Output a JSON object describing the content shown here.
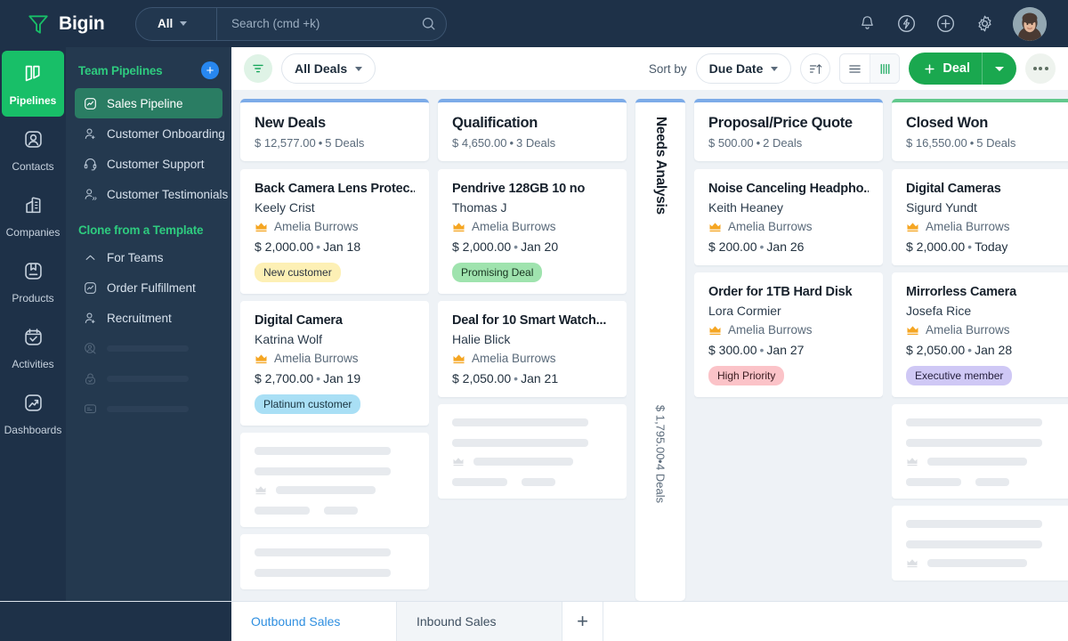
{
  "topbar": {
    "brand": "Bigin",
    "logo_icon": "funnel-logo-icon",
    "search_scope": "All",
    "search_placeholder": "Search (cmd +k)",
    "search_value": "",
    "icons": [
      {
        "name": "bell-icon",
        "label": "Notifications"
      },
      {
        "name": "bolt-icon",
        "label": "Quick actions"
      },
      {
        "name": "plus-circle-icon",
        "label": "Add"
      },
      {
        "name": "gear-icon",
        "label": "Settings"
      }
    ],
    "avatar_alt": "User profile"
  },
  "rail": {
    "items": [
      {
        "label": "Pipelines",
        "icon": "pipelines-icon",
        "active": true
      },
      {
        "label": "Contacts",
        "icon": "contacts-icon",
        "active": false
      },
      {
        "label": "Companies",
        "icon": "companies-icon",
        "active": false
      },
      {
        "label": "Products",
        "icon": "products-icon",
        "active": false
      },
      {
        "label": "Activities",
        "icon": "activities-icon",
        "active": false
      },
      {
        "label": "Dashboards",
        "icon": "dashboards-icon",
        "active": false
      }
    ]
  },
  "sidebar": {
    "team_pipelines_title": "Team Pipelines",
    "add_pipeline_label": "+",
    "pipelines": [
      {
        "label": "Sales Pipeline",
        "icon": "pipeline-chart-icon",
        "active": true
      },
      {
        "label": "Customer Onboarding",
        "icon": "user-add-icon",
        "active": false
      },
      {
        "label": "Customer Support",
        "icon": "headset-icon",
        "active": false
      },
      {
        "label": "Customer Testimonials",
        "icon": "user-quote-icon",
        "active": false
      }
    ],
    "clone_title": "Clone from a Template",
    "templates": [
      {
        "label": "For Teams",
        "icon": "chevron-up-icon"
      },
      {
        "label": "Order Fulfillment",
        "icon": "pipeline-chart-icon"
      },
      {
        "label": "Recruitment",
        "icon": "user-add-icon"
      }
    ],
    "placeholders": [
      {
        "icon": "user-search-icon"
      },
      {
        "icon": "lock-check-icon"
      },
      {
        "icon": "screen-icon"
      }
    ]
  },
  "toolbar": {
    "filter_icon": "filter-icon",
    "view_label": "All Deals",
    "sort_by_label": "Sort by",
    "sort_value": "Due Date",
    "sort_direction_icon": "sort-ascending-icon",
    "view_list_icon": "list-view-icon",
    "view_kanban_icon": "kanban-view-icon",
    "add_deal_label": "Deal",
    "more_icon": "more-options-icon"
  },
  "board": {
    "columns": [
      {
        "name": "New Deals",
        "amount": "$ 12,577.00",
        "count": "5 Deals",
        "accent": "#7cabe8",
        "collapsed": false,
        "cards": [
          {
            "title": "Back Camera Lens Protec...",
            "contact": "Keely Crist",
            "owner": "Amelia Burrows",
            "amount": "$ 2,000.00",
            "date": "Jan 18",
            "tag": "New customer",
            "tag_bg": "#fdf0b5",
            "tag_color": "#3a3320"
          },
          {
            "title": "Digital Camera",
            "contact": "Katrina Wolf",
            "owner": "Amelia Burrows",
            "amount": "$ 2,700.00",
            "date": "Jan 19",
            "tag": "Platinum customer",
            "tag_bg": "#a9dff5",
            "tag_color": "#18323d"
          }
        ],
        "skeletons": 2
      },
      {
        "name": "Qualification",
        "amount": "$ 4,650.00",
        "count": "3 Deals",
        "accent": "#7cabe8",
        "collapsed": false,
        "cards": [
          {
            "title": "Pendrive 128GB 10 no",
            "contact": "Thomas J",
            "owner": "Amelia Burrows",
            "amount": "$ 2,000.00",
            "date": "Jan 20",
            "tag": "Promising Deal",
            "tag_bg": "#9fe3ae",
            "tag_color": "#17331f"
          },
          {
            "title": "Deal for 10 Smart Watch...",
            "contact": "Halie Blick",
            "owner": "Amelia Burrows",
            "amount": "$ 2,050.00",
            "date": "Jan 21",
            "tag": "",
            "tag_bg": "",
            "tag_color": ""
          }
        ],
        "skeletons": 1
      },
      {
        "name": "Needs Analysis",
        "amount": "$ 1,795.00",
        "count": "4 Deals",
        "accent": "#7cabe8",
        "collapsed": true,
        "cards": [],
        "skeletons": 0
      },
      {
        "name": "Proposal/Price Quote",
        "amount": "$ 500.00",
        "count": "2 Deals",
        "accent": "#7cabe8",
        "collapsed": false,
        "cards": [
          {
            "title": "Noise Canceling Headpho...",
            "contact": "Keith Heaney",
            "owner": "Amelia Burrows",
            "amount": "$ 200.00",
            "date": "Jan 26",
            "tag": "",
            "tag_bg": "",
            "tag_color": ""
          },
          {
            "title": "Order for 1TB Hard Disk",
            "contact": "Lora Cormier",
            "owner": "Amelia Burrows",
            "amount": "$ 300.00",
            "date": "Jan 27",
            "tag": "High Priority",
            "tag_bg": "#fbc3c8",
            "tag_color": "#3a1c20"
          }
        ],
        "skeletons": 0
      },
      {
        "name": "Closed Won",
        "amount": "$ 16,550.00",
        "count": "5 Deals",
        "accent": "#62c98d",
        "collapsed": false,
        "cards": [
          {
            "title": "Digital Cameras",
            "contact": "Sigurd Yundt",
            "owner": "Amelia Burrows",
            "amount": "$ 2,000.00",
            "date": "Today",
            "tag": "",
            "tag_bg": "",
            "tag_color": ""
          },
          {
            "title": "Mirrorless Camera",
            "contact": "Josefa Rice",
            "owner": "Amelia Burrows",
            "amount": "$ 2,050.00",
            "date": "Jan 28",
            "tag": "Executive member",
            "tag_bg": "#cfc8f5",
            "tag_color": "#241f3d"
          }
        ],
        "skeletons": 2
      }
    ]
  },
  "tabs": {
    "items": [
      {
        "label": "Outbound Sales",
        "active": true
      },
      {
        "label": "Inbound Sales",
        "active": false
      }
    ],
    "add_label": "+"
  }
}
